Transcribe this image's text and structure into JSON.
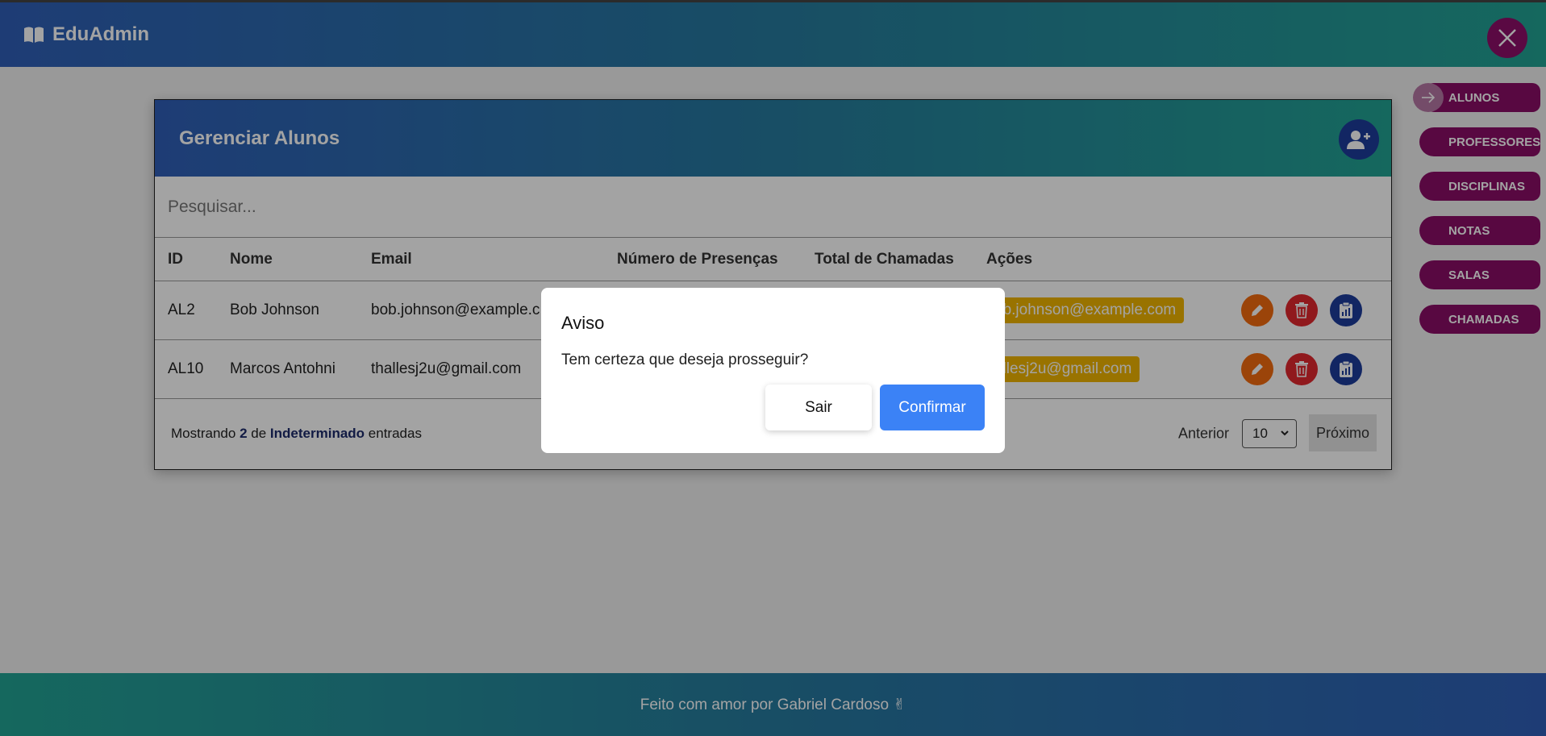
{
  "header": {
    "brand": "EduAdmin",
    "brand_icon": "book-icon",
    "close_icon": "close-icon"
  },
  "sidebar": {
    "items": [
      {
        "label": "ALUNOS",
        "active": true
      },
      {
        "label": "PROFESSORES"
      },
      {
        "label": "DISCIPLINAS"
      },
      {
        "label": "NOTAS"
      },
      {
        "label": "SALAS"
      },
      {
        "label": "CHAMADAS"
      }
    ]
  },
  "card": {
    "title": "Gerenciar Alunos",
    "search_placeholder": "Pesquisar...",
    "columns": [
      "ID",
      "Nome",
      "Email",
      "Número de Presenças",
      "Total de Chamadas",
      "Ações"
    ],
    "rows": [
      {
        "id": "AL2",
        "nome": "Bob Johnson",
        "email": "bob.johnson@example.c",
        "badge": "bob.johnson@example.com",
        "badge_visible": "ob.johnson@example.com"
      },
      {
        "id": "AL10",
        "nome": "Marcos Antohni",
        "email": "thallesj2u@gmail.com",
        "badge": "thallesj2u@gmail.com",
        "badge_visible": "allesj2u@gmail.com"
      }
    ],
    "footer": {
      "showing_prefix": "Mostrando",
      "count": "2",
      "de": "de",
      "total": "Indeterminado",
      "suffix": "entradas",
      "prev": "Anterior",
      "page_size": "10",
      "next": "Próximo"
    }
  },
  "footer": {
    "text": "Feito com amor por Gabriel Cardoso ✌"
  },
  "modal": {
    "title": "Aviso",
    "message": "Tem certeza que deseja prosseguir?",
    "cancel": "Sair",
    "confirm": "Confirmar"
  },
  "colors": {
    "primary_gradient_start": "#2f5fb8",
    "primary_gradient_end": "#22a394",
    "sidebar_item": "#8a0e66",
    "confirm_button": "#3b82f6",
    "badge": "#f0b400"
  }
}
